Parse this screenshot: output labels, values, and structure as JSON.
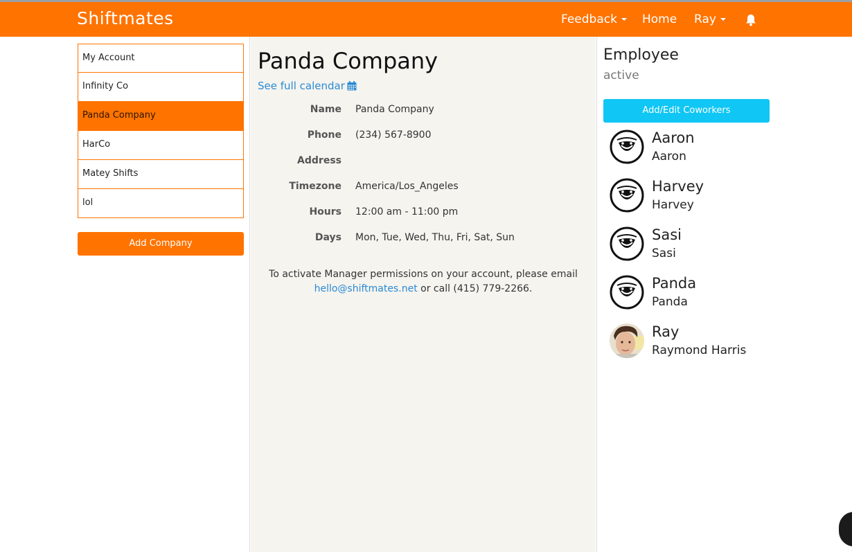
{
  "app": {
    "brand": "Shiftmates"
  },
  "nav": {
    "feedback": "Feedback",
    "home": "Home",
    "user": "Ray",
    "bell_icon": "bell-icon"
  },
  "sidebar": {
    "companies": [
      {
        "label": "My Account",
        "active": false
      },
      {
        "label": "Infinity Co",
        "active": false
      },
      {
        "label": "Panda Company",
        "active": true
      },
      {
        "label": "HarCo",
        "active": false
      },
      {
        "label": "Matey Shifts",
        "active": false
      },
      {
        "label": "lol",
        "active": false
      }
    ],
    "add_company": "Add Company"
  },
  "company": {
    "title": "Panda Company",
    "calendar_link": "See full calendar",
    "calendar_icon": "calendar-icon",
    "details": [
      {
        "label": "Name",
        "value": "Panda Company"
      },
      {
        "label": "Phone",
        "value": "(234) 567-8900"
      },
      {
        "label": "Address",
        "value": ""
      },
      {
        "label": "Timezone",
        "value": "America/Los_Angeles"
      },
      {
        "label": "Hours",
        "value": "12:00 am - 11:00 pm"
      },
      {
        "label": "Days",
        "value": "Mon, Tue, Wed, Thu, Fri, Sat, Sun"
      }
    ],
    "notice_text_1": "To activate Manager permissions on your account, please email",
    "notice_email": "hello@shiftmates.net",
    "notice_text_2": "or call (415) 779-2266."
  },
  "coworkers_panel": {
    "role": "Employee",
    "status": "active",
    "add_edit_button": "Add/Edit Coworkers",
    "coworkers": [
      {
        "name": "Aaron",
        "sub": "Aaron",
        "avatar": "cartoon-face"
      },
      {
        "name": "Harvey",
        "sub": "Harvey",
        "avatar": "cartoon-face"
      },
      {
        "name": "Sasi",
        "sub": "Sasi",
        "avatar": "cartoon-face"
      },
      {
        "name": "Panda",
        "sub": "Panda",
        "avatar": "cartoon-face"
      },
      {
        "name": "Ray",
        "sub": "Raymond Harris",
        "avatar": "photo"
      }
    ]
  },
  "colors": {
    "brand_orange": "#ff7300",
    "accent_cyan": "#10c6f4",
    "link_blue": "#2a8ad4",
    "main_bg": "#f5f4ef"
  }
}
